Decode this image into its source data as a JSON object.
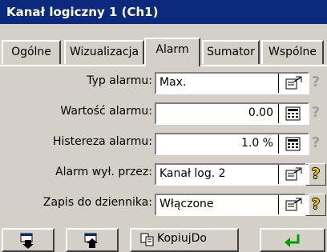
{
  "window": {
    "title": "Kanał logiczny 1 (Ch1)"
  },
  "tabs": [
    {
      "label": "Ogólne"
    },
    {
      "label": "Wizualizacja"
    },
    {
      "label": "Alarm",
      "active": true
    },
    {
      "label": "Sumator"
    },
    {
      "label": "Wspólne"
    }
  ],
  "fields": [
    {
      "label": "Typ alarmu:",
      "value": "Max.",
      "icon": "selection-list-icon",
      "help_enabled": false
    },
    {
      "label": "Wartość alarmu:",
      "value": "0.00",
      "icon": "keypad-icon",
      "help_enabled": false
    },
    {
      "label": "Histereza alarmu:",
      "value": "1.0 %",
      "icon": "keypad-icon",
      "help_enabled": false
    },
    {
      "label": "Alarm wył. przez:",
      "value": "Kanał log. 2",
      "icon": "selection-list-icon",
      "help_enabled": true
    },
    {
      "label": "Zapis do dziennika:",
      "value": "Włączone",
      "icon": "selection-list-icon",
      "help_enabled": true
    }
  ],
  "help_glyph": "?",
  "toolbar": {
    "copy_label": "KopiujDo",
    "buttons": [
      "page-down-icon",
      "page-up-icon",
      "copy-to-icon",
      "enter-icon"
    ]
  },
  "colors": {
    "title_bar": "#0b2a7d",
    "face": "#d4d0c8",
    "help_active": "#e7c700",
    "enter_arrow": "#00a000"
  }
}
